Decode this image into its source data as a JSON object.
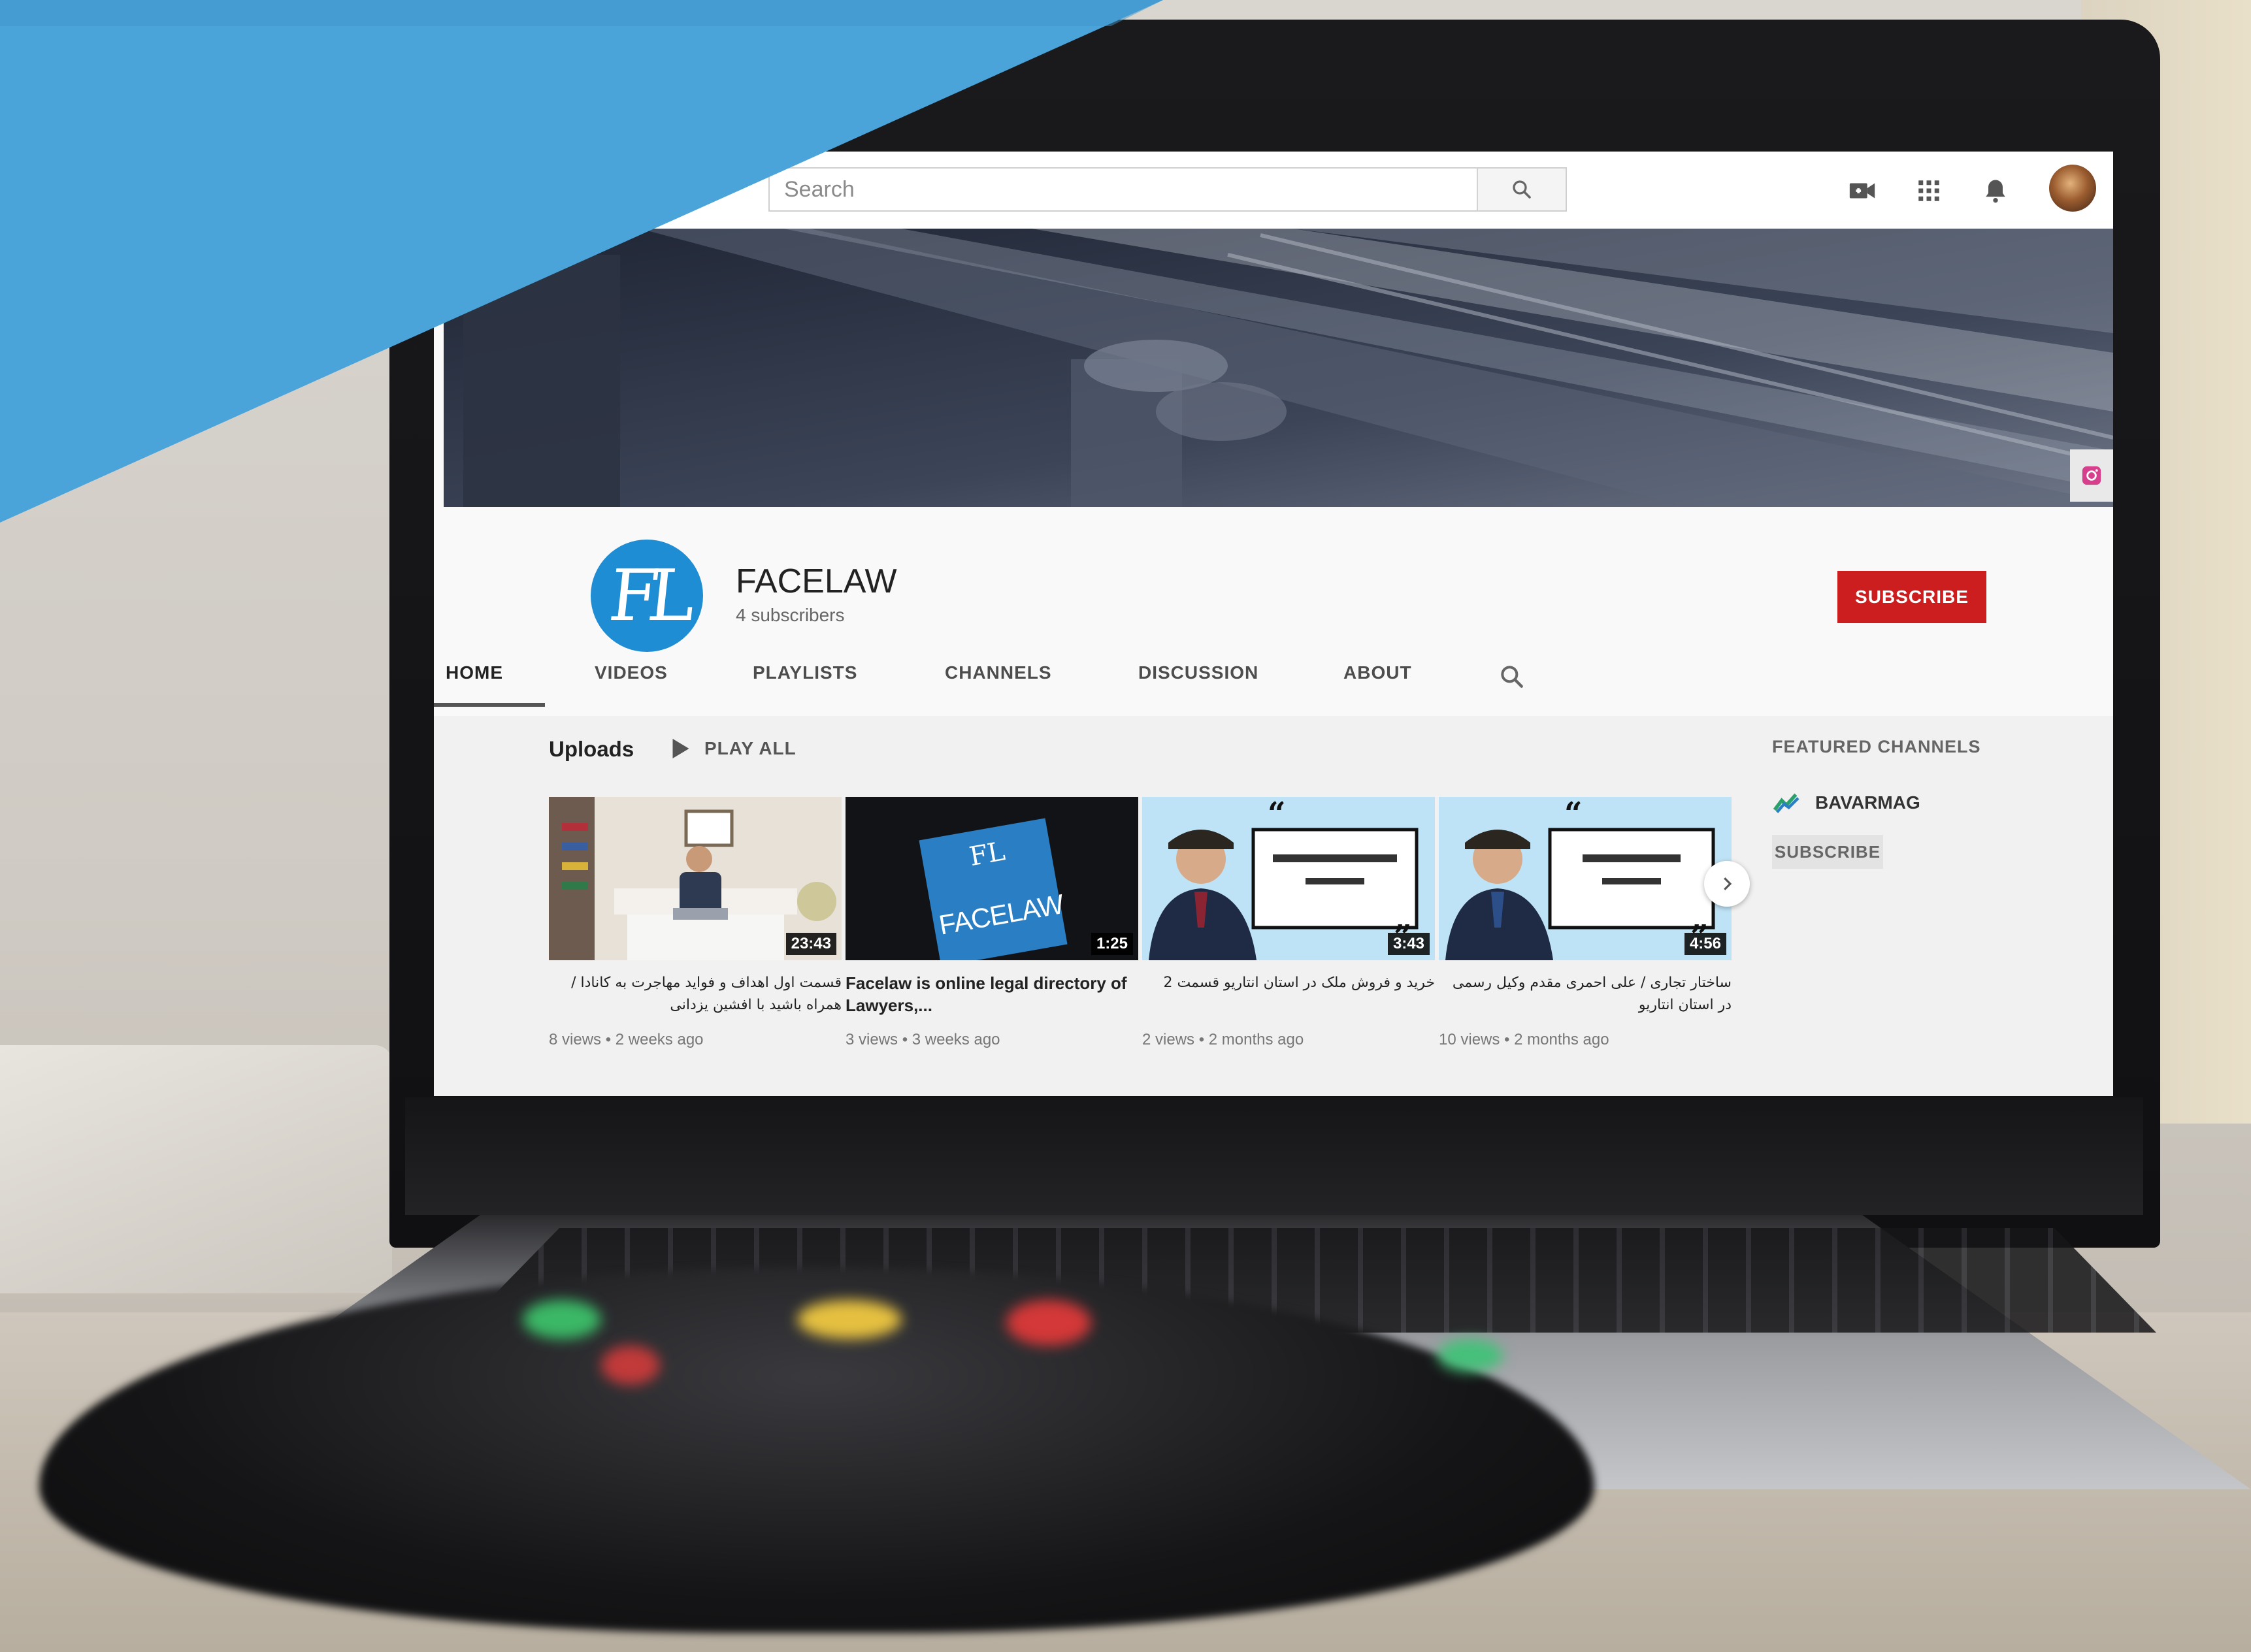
{
  "topbar": {
    "search_placeholder": "Search",
    "icons": [
      "search-icon",
      "video-camera-icon",
      "apps-grid-icon",
      "bell-icon",
      "avatar"
    ]
  },
  "channel": {
    "logo_text": "FL",
    "name": "FACELAW",
    "subscribers": "4 subscribers",
    "subscribe_label": "SUBSCRIBE"
  },
  "tabs": [
    {
      "label": "HOME",
      "active": true
    },
    {
      "label": "VIDEOS",
      "active": false
    },
    {
      "label": "PLAYLISTS",
      "active": false
    },
    {
      "label": "CHANNELS",
      "active": false
    },
    {
      "label": "DISCUSSION",
      "active": false
    },
    {
      "label": "ABOUT",
      "active": false
    }
  ],
  "uploads": {
    "title": "Uploads",
    "play_all_label": "PLAY ALL",
    "videos": [
      {
        "duration": "23:43",
        "title": "قسمت اول اهداف و فواید مهاجرت به کانادا / همراه باشید با افشین یزدانی",
        "meta": "8 views • 2 weeks ago"
      },
      {
        "duration": "1:25",
        "title": "Facelaw is online legal directory of Lawyers,...",
        "meta": "3 views • 3 weeks ago",
        "thumb_text": "FACELAW"
      },
      {
        "duration": "3:43",
        "title": "خرید و فروش ملک در استان انتاریو قسمت 2",
        "meta": "2 views • 2 months ago"
      },
      {
        "duration": "4:56",
        "title": "ساختار تجاری / علی احمری مقدم وکیل رسمی در استان انتاریو",
        "meta": "10 views • 2 months ago"
      }
    ]
  },
  "featured": {
    "title": "FEATURED CHANNELS",
    "channel_name": "BAVARMAG",
    "subscribe_label": "SUBSCRIBE"
  },
  "colors": {
    "banner_blue": "#4aa3d9",
    "subscribe_red": "#cc1e1e",
    "logo_blue": "#1e8dd3",
    "thumb_light_blue": "#bfe3f6"
  }
}
